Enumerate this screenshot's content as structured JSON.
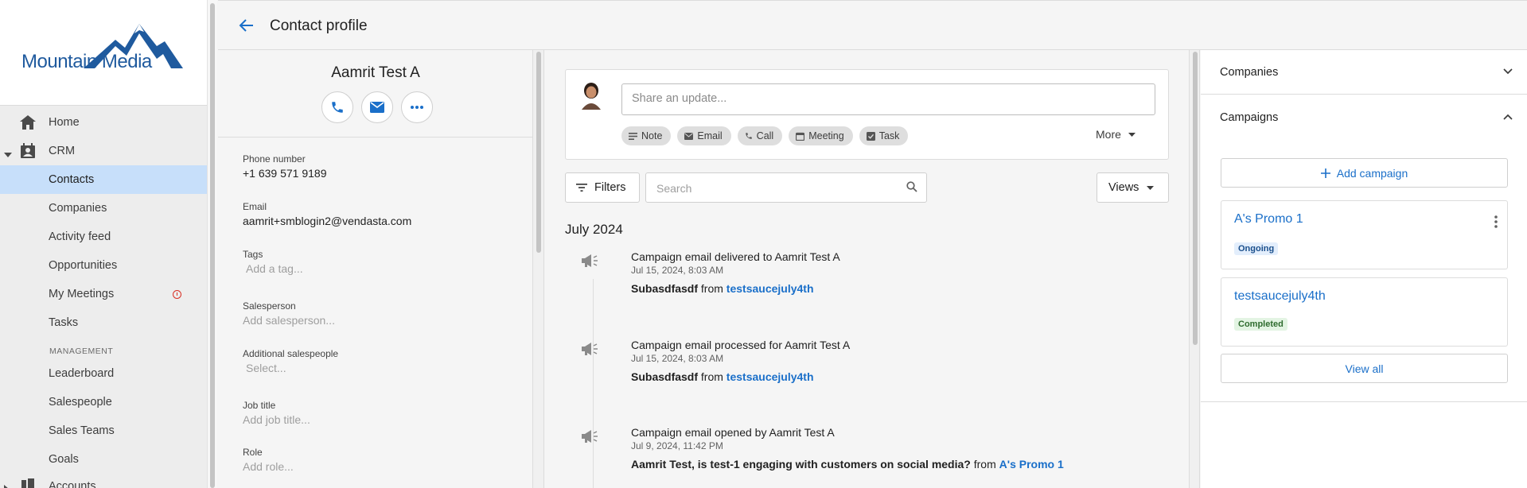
{
  "brand": {
    "logo_text": "Mountain Media",
    "primary_color": "#1f5a9e",
    "link_color": "#1a6fc9"
  },
  "sidebar": {
    "items": [
      {
        "label": "Home",
        "icon": "home-icon"
      },
      {
        "label": "CRM",
        "icon": "crm-icon",
        "expanded": true
      },
      {
        "label": "Contacts",
        "active": true
      },
      {
        "label": "Companies"
      },
      {
        "label": "Activity feed"
      },
      {
        "label": "Opportunities"
      },
      {
        "label": "My Meetings",
        "alert": true
      },
      {
        "label": "Tasks"
      }
    ],
    "section_management": "MANAGEMENT",
    "management_items": [
      {
        "label": "Leaderboard"
      },
      {
        "label": "Salespeople"
      },
      {
        "label": "Sales Teams"
      },
      {
        "label": "Goals"
      }
    ],
    "accounts": {
      "label": "Accounts",
      "icon": "accounts-icon"
    }
  },
  "header": {
    "title": "Contact profile"
  },
  "profile": {
    "name": "Aamrit Test A",
    "fields": [
      {
        "label": "Phone number",
        "value": "+1 639 571 9189"
      },
      {
        "label": "Email",
        "value": "aamrit+smblogin2@vendasta.com"
      },
      {
        "label": "Tags",
        "placeholder": "Add a tag..."
      },
      {
        "label": "Salesperson",
        "placeholder": "Add salesperson..."
      },
      {
        "label": "Additional salespeople",
        "placeholder": "Select..."
      },
      {
        "label": "Job title",
        "placeholder": "Add job title..."
      },
      {
        "label": "Role",
        "placeholder": "Add role..."
      }
    ]
  },
  "composer": {
    "placeholder": "Share an update...",
    "chips": [
      "Note",
      "Email",
      "Call",
      "Meeting",
      "Task"
    ],
    "more": "More"
  },
  "toolbar": {
    "filters": "Filters",
    "search_placeholder": "Search",
    "views": "Views"
  },
  "feed": {
    "month": "July 2024",
    "activities": [
      {
        "title": "Campaign email delivered to Aamrit Test A",
        "date": "Jul 15, 2024, 8:03 AM",
        "subject": "Subasdfasdf",
        "from": "from",
        "campaign": "testsaucejuly4th"
      },
      {
        "title": "Campaign email processed for Aamrit Test A",
        "date": "Jul 15, 2024, 8:03 AM",
        "subject": "Subasdfasdf",
        "from": "from",
        "campaign": "testsaucejuly4th"
      },
      {
        "title": "Campaign email opened by Aamrit Test A",
        "date": "Jul 9, 2024, 11:42 PM",
        "subject": "Aamrit Test, is test-1 engaging with customers on social media?",
        "from": "from",
        "campaign": "A's Promo 1"
      }
    ]
  },
  "right_panel": {
    "companies_title": "Companies",
    "campaigns_title": "Campaigns",
    "add_campaign": "Add campaign",
    "campaigns": [
      {
        "name": "A's Promo 1",
        "status": "Ongoing"
      },
      {
        "name": "testsaucejuly4th",
        "status": "Completed"
      }
    ],
    "view_all": "View all"
  }
}
